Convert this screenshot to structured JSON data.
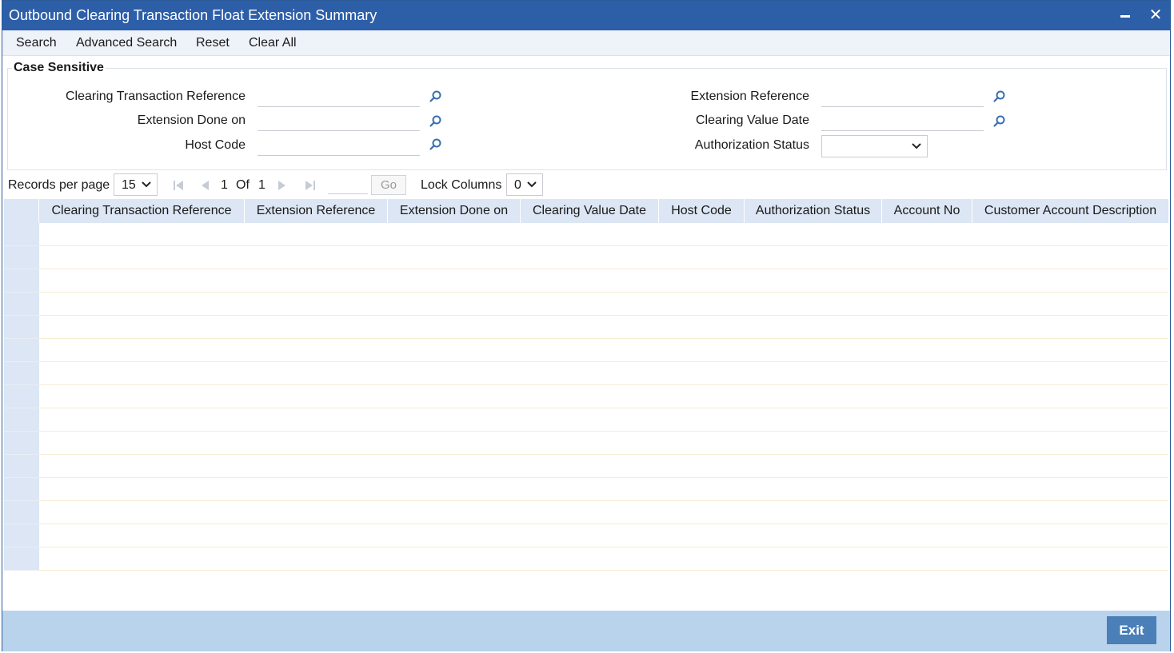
{
  "window": {
    "title": "Outbound Clearing Transaction Float Extension Summary"
  },
  "toolbar": {
    "search": "Search",
    "advanced_search": "Advanced Search",
    "reset": "Reset",
    "clear_all": "Clear All"
  },
  "criteria": {
    "legend": "Case Sensitive",
    "clearing_txn_ref": {
      "label": "Clearing Transaction Reference",
      "value": ""
    },
    "extension_done_on": {
      "label": "Extension Done on",
      "value": ""
    },
    "host_code": {
      "label": "Host Code",
      "value": ""
    },
    "extension_ref": {
      "label": "Extension Reference",
      "value": ""
    },
    "clearing_value_date": {
      "label": "Clearing Value Date",
      "value": ""
    },
    "authorization_status": {
      "label": "Authorization Status",
      "value": ""
    }
  },
  "pager": {
    "records_label": "Records per page",
    "records_value": "15",
    "current_page": "1",
    "of_label": "Of",
    "total_pages": "1",
    "go_label": "Go",
    "lock_label": "Lock Columns",
    "lock_value": "0"
  },
  "table": {
    "columns": [
      "Clearing Transaction Reference",
      "Extension Reference",
      "Extension Done on",
      "Clearing Value Date",
      "Host Code",
      "Authorization Status",
      "Account No",
      "Customer Account Description"
    ],
    "rows": 15
  },
  "footer": {
    "exit_label": "Exit"
  },
  "colors": {
    "titlebar": "#2d5ea8",
    "toolbar_bg": "#eef2f9",
    "grid_header": "#dce6f4",
    "footer_bg": "#bad3ec",
    "exit_button": "#4a7fb8",
    "lens_icon": "#3a6fb0"
  }
}
